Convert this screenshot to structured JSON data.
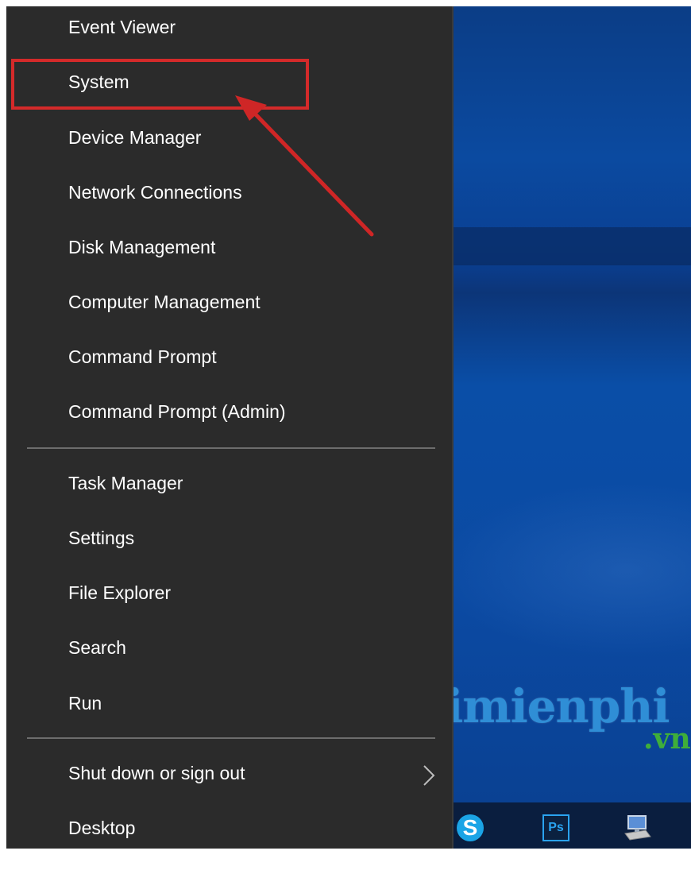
{
  "menu": {
    "items_group1": [
      {
        "label": "Event Viewer"
      },
      {
        "label": "System"
      },
      {
        "label": "Device Manager"
      },
      {
        "label": "Network Connections"
      },
      {
        "label": "Disk Management"
      },
      {
        "label": "Computer Management"
      },
      {
        "label": "Command Prompt"
      },
      {
        "label": "Command Prompt (Admin)"
      }
    ],
    "items_group2": [
      {
        "label": "Task Manager"
      },
      {
        "label": "Settings"
      },
      {
        "label": "File Explorer"
      },
      {
        "label": "Search"
      },
      {
        "label": "Run"
      }
    ],
    "items_group3": [
      {
        "label": "Shut down or sign out",
        "has_submenu": true
      },
      {
        "label": "Desktop"
      }
    ],
    "highlighted_item": "System"
  },
  "watermark": {
    "main": "Taimienphi",
    "sub": ".vn"
  },
  "taskbar": {
    "icons": [
      "skype-icon",
      "photoshop-icon",
      "network-computer-icon"
    ],
    "skype_glyph": "S",
    "ps_glyph": "Ps"
  },
  "colors": {
    "menu_bg": "#2b2b2b",
    "text": "#ffffff",
    "highlight": "#d42a2a",
    "desktop": "#0b4aa0"
  }
}
